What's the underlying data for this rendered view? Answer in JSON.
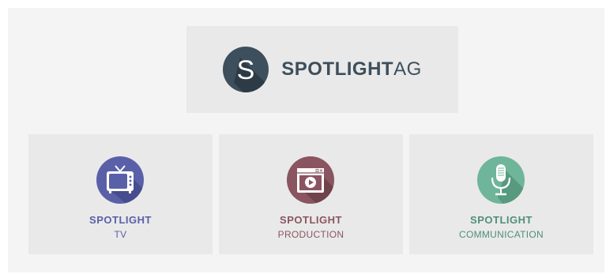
{
  "logo": {
    "letter": "S",
    "brand_bold": "SPOTLIGHT",
    "brand_light": "AG",
    "color": "#3d4f5c"
  },
  "cards": [
    {
      "title": "SPOTLIGHT",
      "subtitle": "TV",
      "icon": "tv-icon",
      "color": "#5a60a8"
    },
    {
      "title": "SPOTLIGHT",
      "subtitle": "PRODUCTION",
      "icon": "video-player-icon",
      "color": "#8a5560"
    },
    {
      "title": "SPOTLIGHT",
      "subtitle": "COMMUNICATION",
      "icon": "microphone-icon",
      "color": "#4f8f78"
    }
  ]
}
